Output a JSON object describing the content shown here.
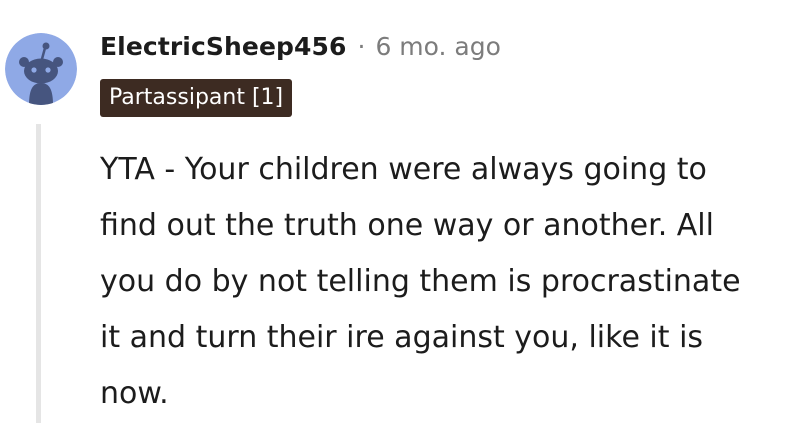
{
  "comment": {
    "author": "ElectricSheep456",
    "separator": "·",
    "timestamp": "6 mo. ago",
    "flair": "Partassipant [1]",
    "body": "YTA - Your children were always going to find out the truth one way or another. All you do by not telling them is procrastinate it and turn their ire against you, like it is now.",
    "avatar_icon": "reddit-snoo-avatar-icon"
  },
  "colors": {
    "avatar_bg": "#8fa9e6",
    "flair_bg": "#3d2b22",
    "meta_text": "#7c7c7c",
    "thread_line": "#e5e5e5"
  }
}
